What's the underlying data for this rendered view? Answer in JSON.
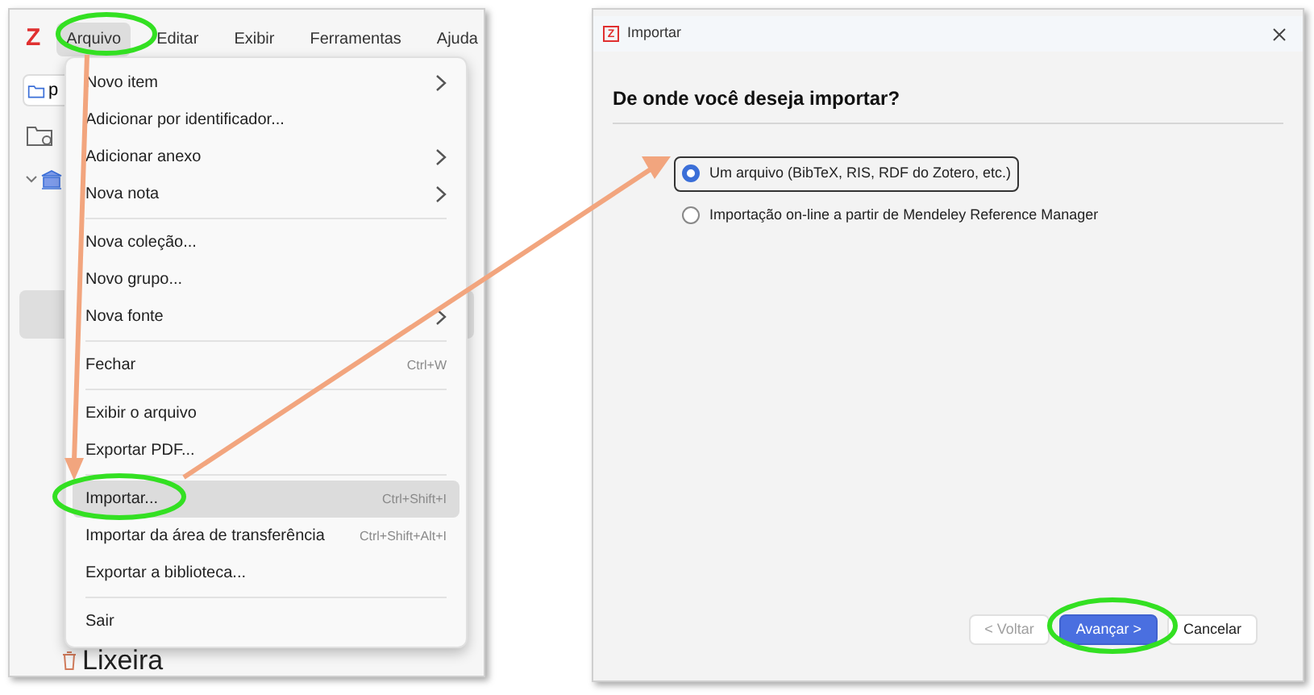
{
  "main_window": {
    "logo": "Z",
    "menubar": [
      {
        "label": "Arquivo",
        "selected": true
      },
      {
        "label": "Editar",
        "selected": false
      },
      {
        "label": "Exibir",
        "selected": false
      },
      {
        "label": "Ferramentas",
        "selected": false
      },
      {
        "label": "Ajuda",
        "selected": false
      }
    ],
    "toolbar_button": "p",
    "trash_label": "Lixeira",
    "menu": [
      {
        "kind": "item",
        "label": "Novo item",
        "submenu": true,
        "selected": false
      },
      {
        "kind": "item",
        "label": "Adicionar por identificador...",
        "submenu": false,
        "selected": false
      },
      {
        "kind": "item",
        "label": "Adicionar anexo",
        "submenu": true,
        "selected": false
      },
      {
        "kind": "item",
        "label": "Nova nota",
        "submenu": true,
        "selected": false
      },
      {
        "kind": "separator"
      },
      {
        "kind": "item",
        "label": "Nova coleção...",
        "submenu": false,
        "selected": false
      },
      {
        "kind": "item",
        "label": "Novo grupo...",
        "submenu": false,
        "selected": false
      },
      {
        "kind": "item",
        "label": "Nova fonte",
        "submenu": true,
        "selected": false
      },
      {
        "kind": "separator"
      },
      {
        "kind": "item",
        "label": "Fechar",
        "shortcut": "Ctrl+W",
        "submenu": false,
        "selected": false
      },
      {
        "kind": "separator"
      },
      {
        "kind": "item",
        "label": "Exibir o arquivo",
        "submenu": false,
        "selected": false
      },
      {
        "kind": "item",
        "label": "Exportar PDF...",
        "submenu": false,
        "selected": false
      },
      {
        "kind": "separator"
      },
      {
        "kind": "item",
        "label": "Importar...",
        "shortcut": "Ctrl+Shift+I",
        "submenu": false,
        "selected": true
      },
      {
        "kind": "item",
        "label": "Importar da área de transferência",
        "shortcut": "Ctrl+Shift+Alt+I",
        "submenu": false,
        "selected": false
      },
      {
        "kind": "item",
        "label": "Exportar a biblioteca...",
        "submenu": false,
        "selected": false
      },
      {
        "kind": "separator"
      },
      {
        "kind": "item",
        "label": "Sair",
        "submenu": false,
        "selected": false
      }
    ]
  },
  "dialog": {
    "logo": "Z",
    "title": "Importar",
    "heading": "De onde você deseja importar?",
    "options": [
      {
        "label": "Um arquivo (BibTeX, RIS, RDF do Zotero, etc.)",
        "selected": true
      },
      {
        "label": "Importação on-line a partir de Mendeley Reference Manager",
        "selected": false
      }
    ],
    "buttons": [
      {
        "kind": "back",
        "label": "< Voltar",
        "disabled": true
      },
      {
        "kind": "primary",
        "label": "Avançar >",
        "disabled": false
      },
      {
        "kind": "cancel",
        "label": "Cancelar",
        "disabled": false
      }
    ]
  }
}
